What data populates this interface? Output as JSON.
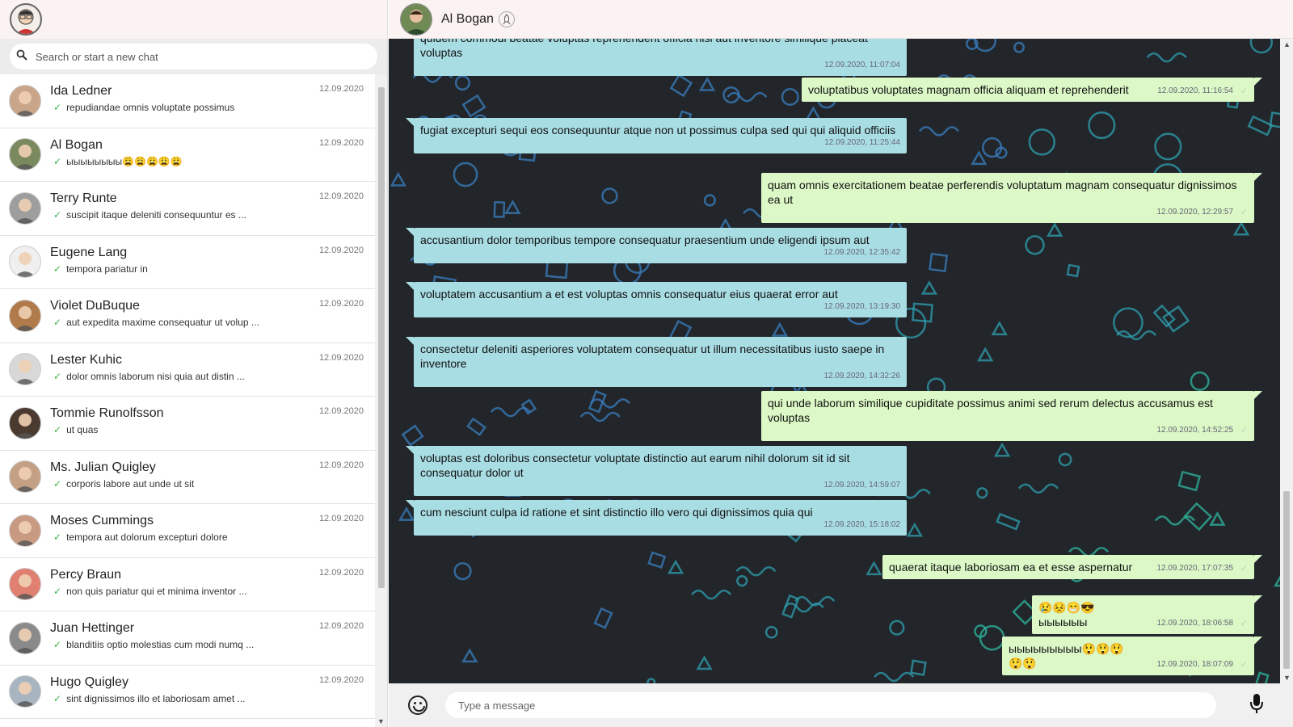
{
  "me": {
    "avatar": "user-avatar"
  },
  "search": {
    "placeholder": "Search or start a new chat",
    "icon": "search-icon"
  },
  "chats": [
    {
      "name": "Ida Ledner",
      "preview": "repudiandae omnis voluptate possimus",
      "date": "12.09.2020",
      "avatar_color": "#c9a68a"
    },
    {
      "name": "Al Bogan",
      "preview": "ыыыыыыыы😩😩😩😩😩",
      "date": "12.09.2020",
      "avatar_color": "#7a8a5e"
    },
    {
      "name": "Terry Runte",
      "preview": "suscipit itaque deleniti consequuntur es ...",
      "date": "12.09.2020",
      "avatar_color": "#9e9e9e"
    },
    {
      "name": "Eugene Lang",
      "preview": "tempora pariatur in",
      "date": "12.09.2020",
      "avatar_color": "#efefef"
    },
    {
      "name": "Violet DuBuque",
      "preview": "aut expedita maxime consequatur ut volup ...",
      "date": "12.09.2020",
      "avatar_color": "#b07a4a"
    },
    {
      "name": "Lester Kuhic",
      "preview": "dolor omnis laborum nisi quia aut distin ...",
      "date": "12.09.2020",
      "avatar_color": "#d8d8d8"
    },
    {
      "name": "Tommie Runolfsson",
      "preview": "ut quas",
      "date": "12.09.2020",
      "avatar_color": "#4a3a30"
    },
    {
      "name": "Ms. Julian Quigley",
      "preview": "corporis labore aut unde ut sit",
      "date": "12.09.2020",
      "avatar_color": "#c4a184"
    },
    {
      "name": "Moses Cummings",
      "preview": "tempora aut dolorum excepturi dolore",
      "date": "12.09.2020",
      "avatar_color": "#c99a82"
    },
    {
      "name": "Percy Braun",
      "preview": "non quis pariatur qui et minima inventor ...",
      "date": "12.09.2020",
      "avatar_color": "#e08070"
    },
    {
      "name": "Juan Hettinger",
      "preview": "blanditiis optio molestias cum modi numq ...",
      "date": "12.09.2020",
      "avatar_color": "#8a8a8a"
    },
    {
      "name": "Hugo Quigley",
      "preview": "sint dignissimos illo et laboriosam amet ...",
      "date": "12.09.2020",
      "avatar_color": "#a8b4c0"
    }
  ],
  "contact": {
    "name": "Al Bogan"
  },
  "messages": [
    {
      "dir": "in",
      "text": "quidem commodi beatae voluptas reprehenderit officia nisi aut inventore similique placeat voluptas",
      "time": "12.09.2020, 11:07:04"
    },
    {
      "dir": "out",
      "text": "voluptatibus voluptates magnam officia aliquam et reprehenderit",
      "time": "12.09.2020, 11:16:54"
    },
    {
      "dir": "in",
      "text": "fugiat excepturi sequi eos consequuntur atque non ut possimus culpa sed qui qui aliquid officiis",
      "time": "12.09.2020, 11:25:44"
    },
    {
      "dir": "out",
      "text": "quam omnis exercitationem beatae perferendis voluptatum magnam consequatur dignissimos ea ut",
      "time": "12.09.2020, 12:29:57"
    },
    {
      "dir": "in",
      "text": "accusantium dolor temporibus tempore consequatur praesentium unde eligendi ipsum aut",
      "time": "12.09.2020, 12:35:42"
    },
    {
      "dir": "in",
      "text": "voluptatem accusantium a et est voluptas omnis consequatur eius quaerat error aut",
      "time": "12.09.2020, 13:19:30"
    },
    {
      "dir": "in",
      "text": "consectetur deleniti asperiores voluptatem consequatur ut illum necessitatibus iusto saepe in inventore",
      "time": "12.09.2020, 14:32:26"
    },
    {
      "dir": "out",
      "text": "qui unde laborum similique cupiditate possimus animi sed rerum delectus accusamus est voluptas",
      "time": "12.09.2020, 14:52:25"
    },
    {
      "dir": "in",
      "text": "voluptas est doloribus consectetur voluptate distinctio aut earum nihil dolorum sit id sit consequatur dolor ut",
      "time": "12.09.2020, 14:59:07"
    },
    {
      "dir": "in",
      "text": "cum nesciunt culpa id ratione et sint distinctio illo vero qui dignissimos quia qui",
      "time": "12.09.2020, 15:18:02"
    },
    {
      "dir": "out",
      "text": "quaerat itaque laboriosam ea et esse aspernatur",
      "time": "12.09.2020, 17:07:35"
    },
    {
      "dir": "out",
      "text": "😢😣😁😎ыыыыыы",
      "time": "12.09.2020, 18:06:58"
    },
    {
      "dir": "out",
      "text": "ыыыыыыыыы😲😲😲😲😲",
      "time": "12.09.2020, 18:07:09"
    }
  ],
  "composer": {
    "placeholder": "Type a message",
    "emoji_icon": "emoji-icon",
    "mic_icon": "microphone-icon"
  },
  "colors": {
    "incoming": "#a9dde4",
    "outgoing": "#dcf8c6",
    "chat_bg": "#22262b",
    "header_bg": "#fbf2f2",
    "tick": "#39b54a"
  }
}
